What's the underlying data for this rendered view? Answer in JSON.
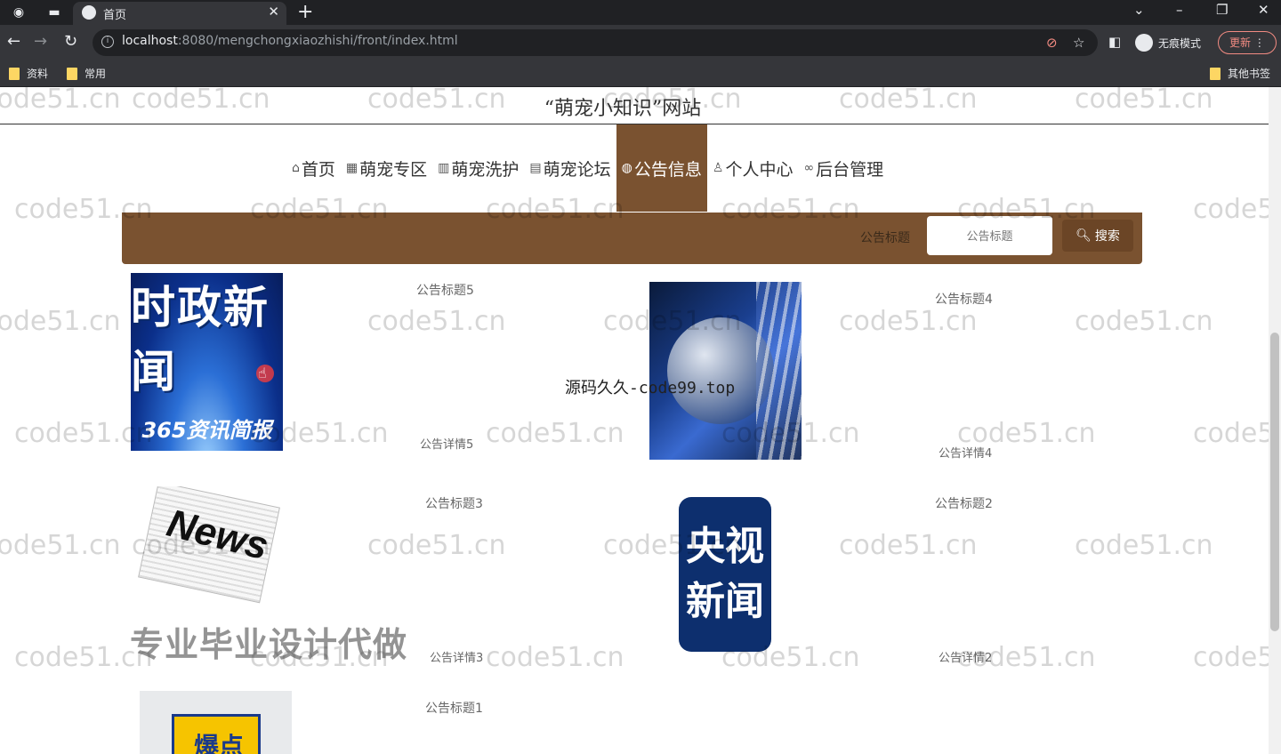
{
  "browser": {
    "tab_title": "首页",
    "url_host": "localhost",
    "url_rest": ":8080/mengchongxiaozhishi/front/index.html",
    "incognito_label": "无痕模式",
    "update_label": "更新",
    "bookmarks": [
      "资料",
      "常用"
    ],
    "other_bookmarks": "其他书签"
  },
  "site": {
    "title": "“萌宠小知识”网站"
  },
  "nav": {
    "items": [
      {
        "icon": "home-icon",
        "glyph": "⌂",
        "label": "首页"
      },
      {
        "icon": "grid-icon",
        "glyph": "▦",
        "label": "萌宠专区"
      },
      {
        "icon": "wash-icon",
        "glyph": "▥",
        "label": "萌宠洗护"
      },
      {
        "icon": "forum-icon",
        "glyph": "▤",
        "label": "萌宠论坛"
      },
      {
        "icon": "globe-icon",
        "glyph": "◍",
        "label": "公告信息"
      },
      {
        "icon": "user-icon",
        "glyph": "♙",
        "label": "个人中心"
      },
      {
        "icon": "link-icon",
        "glyph": "∞",
        "label": "后台管理"
      }
    ],
    "active_index": 4
  },
  "search": {
    "label": "公告标题",
    "placeholder": "公告标题",
    "button_label": "搜索"
  },
  "notices": [
    {
      "title": "公告标题5",
      "detail": "公告详情5",
      "image_text": [
        "时政新闻",
        "365资讯简报"
      ]
    },
    {
      "title": "公告标题4",
      "detail": "公告详情4"
    },
    {
      "title": "公告标题3",
      "detail": "公告详情3",
      "image_text": [
        "News"
      ]
    },
    {
      "title": "公告标题2",
      "detail": "公告详情2",
      "image_text": [
        "央视",
        "新闻"
      ]
    },
    {
      "title": "公告标题1",
      "image_text": [
        "爆点"
      ]
    }
  ],
  "overlays": {
    "watermark": "code51.cn",
    "center_text": "源码久久-code99.top",
    "promo_text": "专业毕业设计代做"
  },
  "colors": {
    "accent": "#7a5230",
    "button": "#6b4526"
  }
}
